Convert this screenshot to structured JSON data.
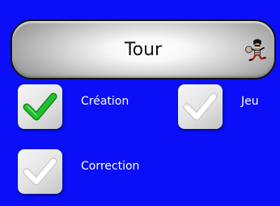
{
  "header": {
    "label": "Tour",
    "icon": "burglar-icon"
  },
  "options": [
    {
      "label": "Création",
      "checked": true,
      "icon": "checkmark-icon",
      "check_color": "#17b325"
    },
    {
      "label": "Jeu",
      "checked": false,
      "icon": "checkmark-icon"
    },
    {
      "label": "Correction",
      "checked": false,
      "icon": "checkmark-icon"
    }
  ],
  "colors": {
    "background": "#0a0ff7",
    "checked_mark": "#17b325",
    "unchecked_mark": "#ffffff",
    "label_text": "#ffffff"
  }
}
